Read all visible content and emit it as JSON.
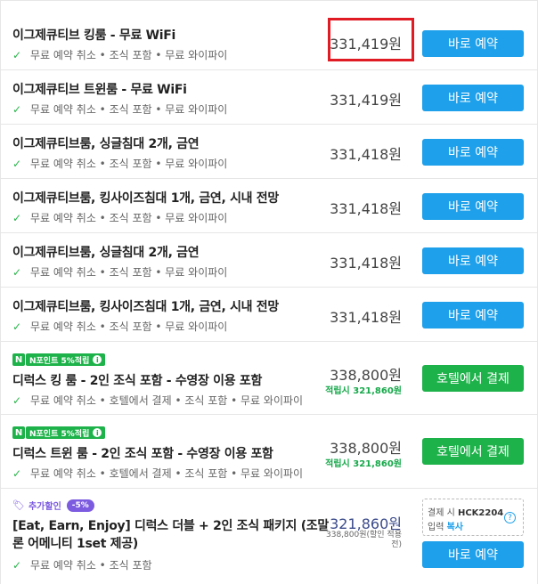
{
  "rooms": [
    {
      "name": "이그제큐티브 킹룸 - 무료 WiFi",
      "sub": "무료 예약 취소 • 조식 포함 • 무료 와이파이",
      "price": "331,419원",
      "button": "바로 예약"
    },
    {
      "name": "이그제큐티브 트윈룸 - 무료 WiFi",
      "sub": "무료 예약 취소 • 조식 포함 • 무료 와이파이",
      "price": "331,419원",
      "button": "바로 예약"
    },
    {
      "name": "이그제큐티브룸, 싱글침대 2개, 금연",
      "sub": "무료 예약 취소 • 조식 포함 • 무료 와이파이",
      "price": "331,418원",
      "button": "바로 예약"
    },
    {
      "name": "이그제큐티브룸, 킹사이즈침대 1개, 금연, 시내 전망",
      "sub": "무료 예약 취소 • 조식 포함 • 무료 와이파이",
      "price": "331,418원",
      "button": "바로 예약"
    },
    {
      "name": "이그제큐티브룸, 싱글침대 2개, 금연",
      "sub": "무료 예약 취소 • 조식 포함 • 무료 와이파이",
      "price": "331,418원",
      "button": "바로 예약"
    },
    {
      "name": "이그제큐티브룸, 킹사이즈침대 1개, 금연, 시내 전망",
      "sub": "무료 예약 취소 • 조식 포함 • 무료 와이파이",
      "price": "331,418원",
      "button": "바로 예약"
    }
  ],
  "npoint_rooms": [
    {
      "badge_logo": "N",
      "badge": "N포인트 5%적립",
      "name": "디럭스 킹 룸 - 2인 조식 포함 - 수영장 이용 포함",
      "sub": "무료 예약 취소 • 호텔에서 결제 • 조식 포함 • 무료 와이파이",
      "price": "338,800원",
      "points": "적립시 321,860원",
      "button": "호텔에서 결제"
    },
    {
      "badge_logo": "N",
      "badge": "N포인트 5%적립",
      "name": "디럭스 트윈 룸 - 2인 조식 포함 - 수영장 이용 포함",
      "sub": "무료 예약 취소 • 호텔에서 결제 • 조식 포함 • 무료 와이파이",
      "price": "338,800원",
      "points": "적립시 321,860원",
      "button": "호텔에서 결제"
    }
  ],
  "promo_room": {
    "extra_label": "추가할인",
    "discount": "-5%",
    "name": "[Eat, Earn, Enjoy] 디럭스 더블 + 2인 조식 패키지 (조말론 어메니티 1set 제공)",
    "sub": "무료 예약 취소 • 조식 포함",
    "price": "321,860원",
    "orig_price": "338,800원(할인 적용 전)",
    "coupon_prefix": "결제 시",
    "coupon_code": "HCK2204",
    "coupon_input": "입력",
    "coupon_copy": "복사",
    "button": "바로 예약"
  },
  "colors": {
    "accent_blue": "#1ea0ea",
    "accent_green": "#1eb24a",
    "highlight_red": "#e01b24",
    "promo_purple": "#7c5be0"
  }
}
